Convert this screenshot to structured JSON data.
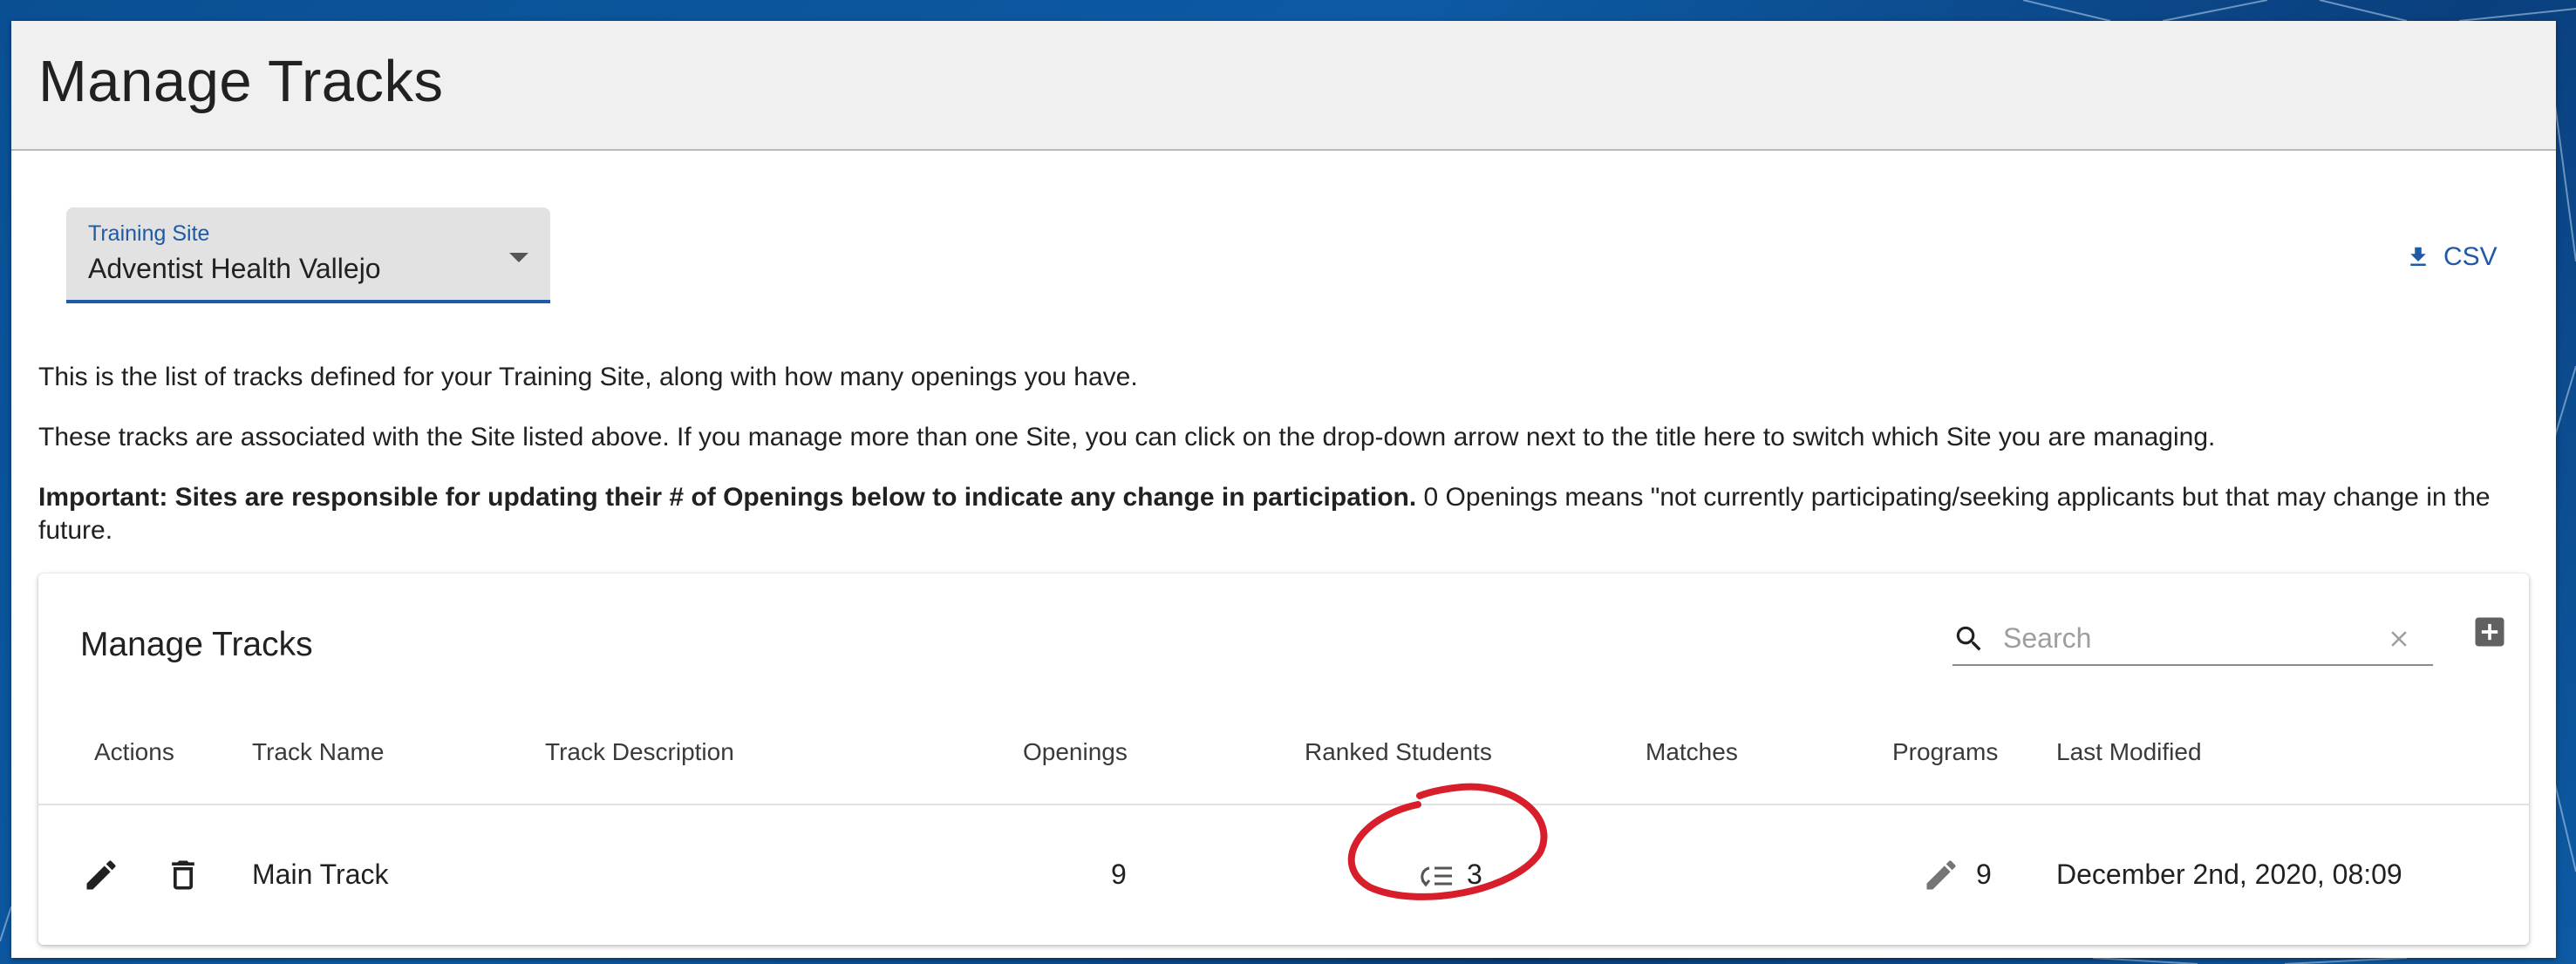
{
  "header": {
    "title": "Manage Tracks"
  },
  "site_select": {
    "label": "Training Site",
    "value": "Adventist Health Vallejo"
  },
  "csv_button": {
    "label": "CSV"
  },
  "intro": {
    "line1": "This is the list of tracks defined for your Training Site, along with how many openings you have.",
    "line2": "These tracks are associated with the Site listed above. If you manage more than one Site, you can click on the drop-down arrow next to the title here to switch which Site you are managing.",
    "line3_bold": "Important: Sites are responsible for updating their # of Openings below to indicate any change in participation.",
    "line3_rest": " 0 Openings means \"not currently participating/seeking applicants but that may change in the future."
  },
  "table": {
    "title": "Manage Tracks",
    "search_placeholder": "Search",
    "columns": {
      "actions": "Actions",
      "track_name": "Track Name",
      "track_description": "Track Description",
      "openings": "Openings",
      "ranked_students": "Ranked Students",
      "matches": "Matches",
      "programs": "Programs",
      "last_modified": "Last Modified"
    },
    "rows": [
      {
        "track_name": "Main Track",
        "track_description": "",
        "openings": "9",
        "ranked_students": "3",
        "matches": "",
        "programs": "9",
        "last_modified": "December 2nd, 2020, 08:09"
      }
    ]
  },
  "colors": {
    "accent": "#1f5aa6",
    "annotation": "#d81e2b",
    "header_bg": "#f0f0f0"
  },
  "icons": [
    "download-icon",
    "search-icon",
    "close-icon",
    "add-box-icon",
    "edit-icon",
    "delete-icon",
    "ranked-list-icon"
  ]
}
